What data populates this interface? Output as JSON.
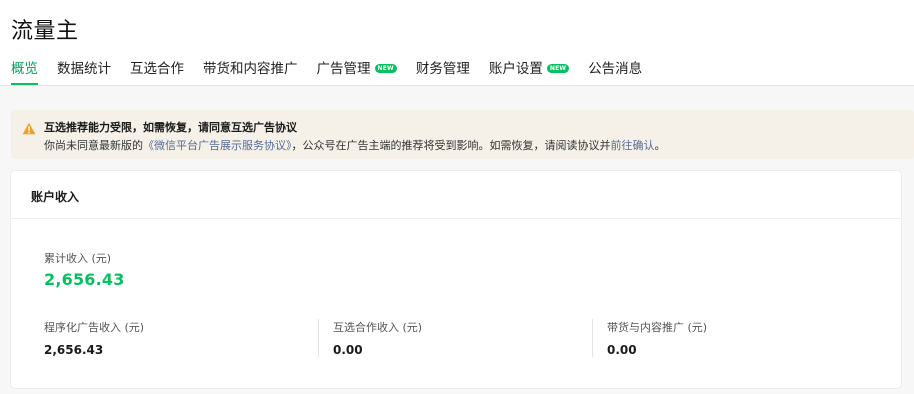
{
  "page": {
    "title": "流量主"
  },
  "tabs": [
    {
      "label": "概览",
      "active": true,
      "badge": ""
    },
    {
      "label": "数据统计",
      "active": false,
      "badge": ""
    },
    {
      "label": "互选合作",
      "active": false,
      "badge": ""
    },
    {
      "label": "带货和内容推广",
      "active": false,
      "badge": ""
    },
    {
      "label": "广告管理",
      "active": false,
      "badge": "NEW"
    },
    {
      "label": "财务管理",
      "active": false,
      "badge": ""
    },
    {
      "label": "账户设置",
      "active": false,
      "badge": "NEW"
    },
    {
      "label": "公告消息",
      "active": false,
      "badge": ""
    }
  ],
  "notice": {
    "icon": "warning-icon",
    "title": "互选推荐能力受限，如需恢复，请同意互选广告协议",
    "body_prefix": "你尚未同意最新版的",
    "agreement_link": "《微信平台广告展示服务协议》",
    "body_middle": "，公众号在广告主端的推荐将受到影响。如需恢复，请阅读协议并",
    "confirm_link": "前往确认",
    "body_suffix": "。"
  },
  "income": {
    "card_title": "账户收入",
    "total_label": "累计收入 (元)",
    "total_value": "2,656.43",
    "metrics": [
      {
        "label": "程序化广告收入 (元)",
        "value": "2,656.43"
      },
      {
        "label": "互选合作收入 (元)",
        "value": "0.00"
      },
      {
        "label": "带货与内容推广 (元)",
        "value": "0.00"
      }
    ]
  },
  "colors": {
    "accent": "#07c160",
    "link": "#576b95",
    "warning": "#f0a020",
    "notice_bg": "#f5f1e8"
  }
}
